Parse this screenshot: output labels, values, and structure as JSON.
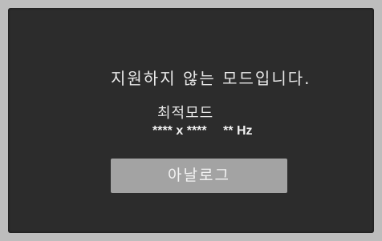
{
  "osd": {
    "message": "지원하지 않는 모드입니다.",
    "optimal_mode_label": "최적모드",
    "resolution": {
      "width": "****",
      "separator": "x",
      "height": "****",
      "refresh": "**",
      "unit": "Hz"
    },
    "input_button_label": "아날로그"
  }
}
